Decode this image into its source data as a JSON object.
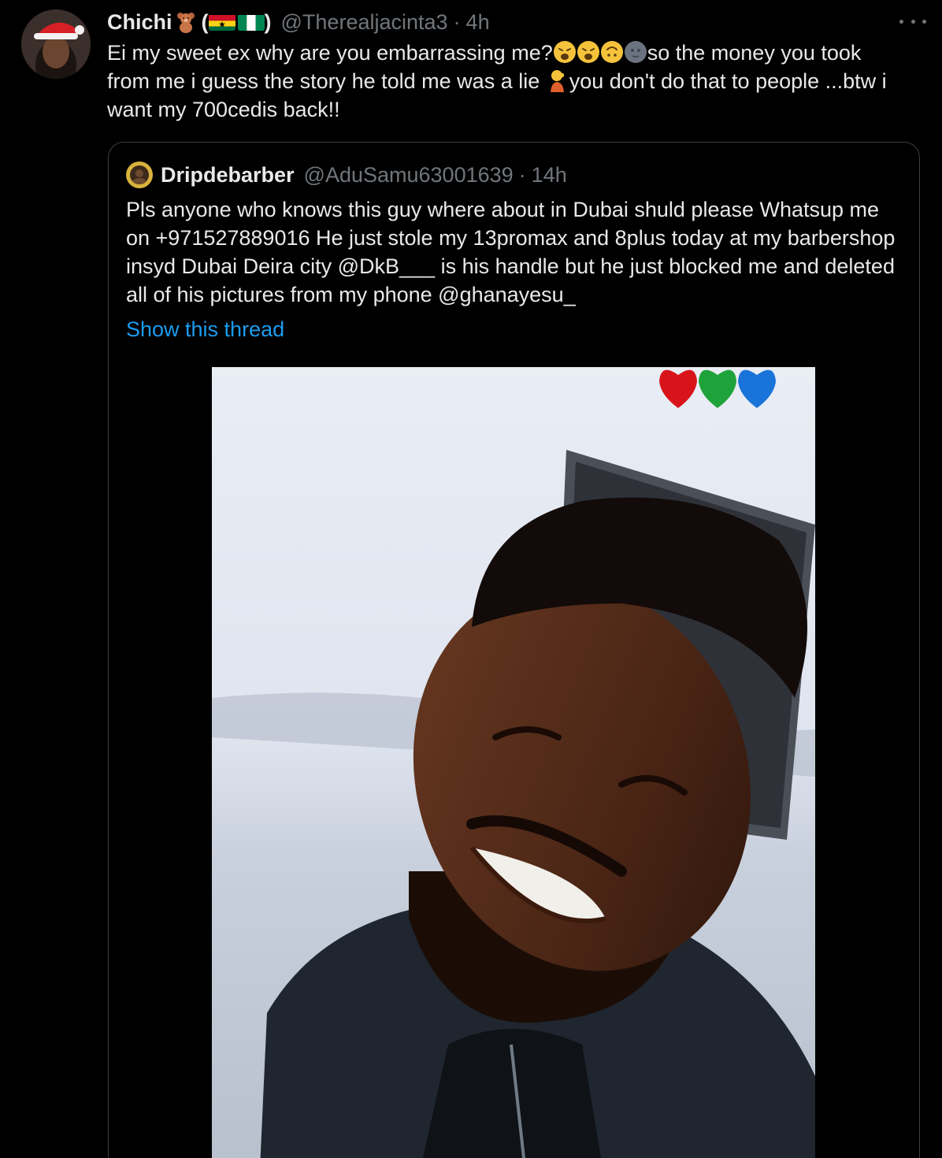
{
  "tweet": {
    "display_name": "Chichi",
    "handle": "@Therealjacinta3",
    "separator": "·",
    "time": "4h",
    "text_part1": "Ei my sweet ex why are you embarrassing me?",
    "text_part2": "so the money you took from me i guess the story he told me was a lie ",
    "text_part3": "you don't do that to people ...btw i want my 700cedis back!!",
    "paren_open": "(",
    "paren_close": ")"
  },
  "quoted": {
    "display_name": "Dripdebarber",
    "handle": "@AduSamu63001639",
    "separator": "·",
    "time": "14h",
    "text": "Pls anyone who knows this guy where about in Dubai shuld please Whatsup me on +971527889016 He just stole my 13promax and 8plus today at my barbershop insyd Dubai Deira city  @DkB___ is his handle but he just blocked me  and deleted all of his pictures from my phone @ghanayesu_",
    "show_thread_label": "Show this thread"
  },
  "colors": {
    "background": "#000000",
    "text": "#e7e9ea",
    "secondary": "#71767b",
    "link": "#1d9bf0",
    "border": "#3a3f44"
  },
  "icons": {
    "more": "more-horizontal-icon",
    "bear": "teddy-bear-icon",
    "flag1": "ghana-flag-icon",
    "flag2": "nigeria-flag-icon"
  }
}
